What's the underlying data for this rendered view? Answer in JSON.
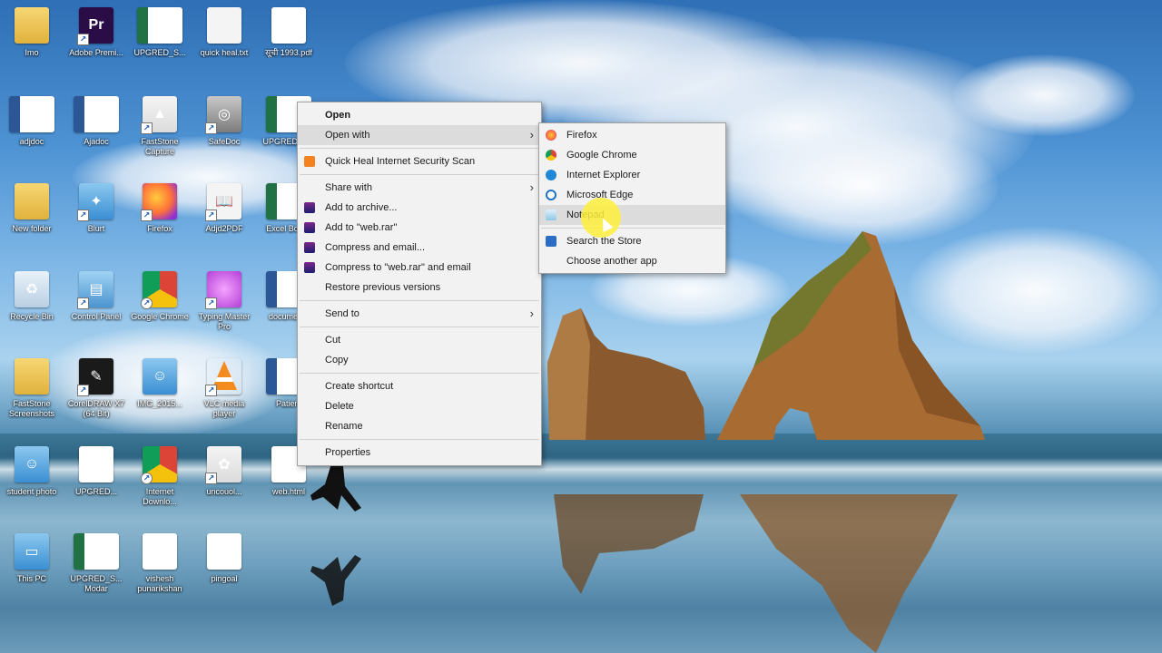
{
  "desktop_icons": [
    {
      "label": "Imo",
      "kind": "folder"
    },
    {
      "label": "Adobe Premi...",
      "kind": "pr"
    },
    {
      "label": "UPGRED_S...",
      "kind": "excel"
    },
    {
      "label": "quick heal.txt",
      "kind": "doc"
    },
    {
      "label": "सूची 1993.pdf",
      "kind": "pdf"
    },
    {
      "label": "adjdoc",
      "kind": "word"
    },
    {
      "label": "Ajadoc",
      "kind": "word"
    },
    {
      "label": "FastStone Capture",
      "kind": "red"
    },
    {
      "label": "SafeDoc",
      "kind": "gray"
    },
    {
      "label": "UPGRED_S...",
      "kind": "excel"
    },
    {
      "label": "New folder",
      "kind": "folder"
    },
    {
      "label": "Blurt",
      "kind": "blurt"
    },
    {
      "label": "Firefox",
      "kind": "firefox"
    },
    {
      "label": "Adjd2PDF",
      "kind": "book"
    },
    {
      "label": "Excel Books",
      "kind": "excel"
    },
    {
      "label": "Recycle Bin",
      "kind": "recycle"
    },
    {
      "label": "Control Panel",
      "kind": "panel"
    },
    {
      "label": "Google Chrome",
      "kind": "chrome"
    },
    {
      "label": "Typing Master Pro",
      "kind": "pink"
    },
    {
      "label": "documents",
      "kind": "word"
    },
    {
      "label": "FastStone Screenshots",
      "kind": "folder"
    },
    {
      "label": "CorelDRAW X7 (64 Bit)",
      "kind": "dark"
    },
    {
      "label": "IMG_2015...",
      "kind": "photo"
    },
    {
      "label": "VLC media player",
      "kind": "vlc"
    },
    {
      "label": "Patient",
      "kind": "word"
    },
    {
      "label": "student photo",
      "kind": "photo"
    },
    {
      "label": "UPGRED...",
      "kind": "pdf"
    },
    {
      "label": "Internet Downlo...",
      "kind": "idm"
    },
    {
      "label": "uncouol...",
      "kind": "game"
    },
    {
      "label": "web.html",
      "kind": "edge"
    },
    {
      "label": "This PC",
      "kind": "monitor"
    },
    {
      "label": "UPGRED_S... Modar",
      "kind": "excel"
    },
    {
      "label": "vishesh punarikshan",
      "kind": "pdf"
    },
    {
      "label": "pingoal",
      "kind": "pdf"
    }
  ],
  "context_menu": {
    "items": [
      {
        "label": "Open",
        "bold": true
      },
      {
        "label": "Open with",
        "submenu": true,
        "highlighted": true
      },
      {
        "sep": true
      },
      {
        "label": "Quick Heal Internet Security Scan",
        "icon": "quickheal"
      },
      {
        "sep": true
      },
      {
        "label": "Share with",
        "submenu": true
      },
      {
        "label": "Add to archive...",
        "icon": "rar"
      },
      {
        "label": "Add to \"web.rar\"",
        "icon": "rar"
      },
      {
        "label": "Compress and email...",
        "icon": "rar"
      },
      {
        "label": "Compress to \"web.rar\" and email",
        "icon": "rar"
      },
      {
        "label": "Restore previous versions"
      },
      {
        "sep": true
      },
      {
        "label": "Send to",
        "submenu": true
      },
      {
        "sep": true
      },
      {
        "label": "Cut"
      },
      {
        "label": "Copy"
      },
      {
        "sep": true
      },
      {
        "label": "Create shortcut"
      },
      {
        "label": "Delete"
      },
      {
        "label": "Rename"
      },
      {
        "sep": true
      },
      {
        "label": "Properties"
      }
    ]
  },
  "open_with_menu": {
    "items": [
      {
        "label": "Firefox",
        "icon": "firefox"
      },
      {
        "label": "Google Chrome",
        "icon": "chrome"
      },
      {
        "label": "Internet Explorer",
        "icon": "ie"
      },
      {
        "label": "Microsoft Edge",
        "icon": "edge"
      },
      {
        "label": "Notepad",
        "icon": "notepad",
        "highlighted": true
      },
      {
        "sep": true
      },
      {
        "label": "Search the Store",
        "icon": "store"
      },
      {
        "label": "Choose another app"
      }
    ]
  },
  "colors": {
    "menu_bg": "#f2f2f2",
    "menu_highlight": "#dcdcdc",
    "cursor_highlight": "#fff03c"
  }
}
